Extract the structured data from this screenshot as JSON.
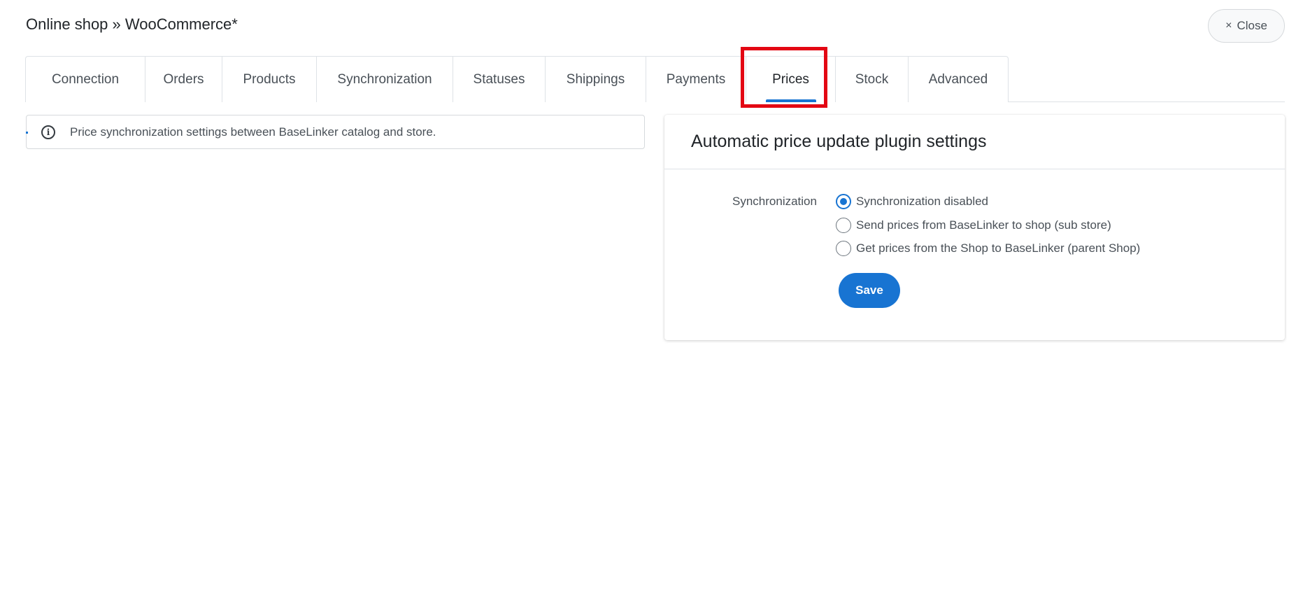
{
  "header": {
    "title": "Online shop » WooCommerce*",
    "close_label": "Close",
    "close_icon": "×"
  },
  "tabs": [
    {
      "label": "Connection",
      "active": false
    },
    {
      "label": "Orders",
      "active": false
    },
    {
      "label": "Products",
      "active": false
    },
    {
      "label": "Synchronization",
      "active": false
    },
    {
      "label": "Statuses",
      "active": false
    },
    {
      "label": "Shippings",
      "active": false
    },
    {
      "label": "Payments",
      "active": false
    },
    {
      "label": "Prices",
      "active": true
    },
    {
      "label": "Stock",
      "active": false
    },
    {
      "label": "Advanced",
      "active": false
    }
  ],
  "info": {
    "icon": "info-icon",
    "text": "Price synchronization settings between BaseLinker catalog and store."
  },
  "settings": {
    "title": "Automatic price update plugin settings",
    "field_label": "Synchronization",
    "options": [
      {
        "label": "Synchronization disabled",
        "checked": true
      },
      {
        "label": "Send prices from BaseLinker to shop (sub store)",
        "checked": false
      },
      {
        "label": "Get prices from the Shop to BaseLinker (parent Shop)",
        "checked": false
      }
    ],
    "save_label": "Save"
  },
  "colors": {
    "accent": "#1874d2",
    "highlight": "#e30613",
    "border": "#dee2e6"
  }
}
